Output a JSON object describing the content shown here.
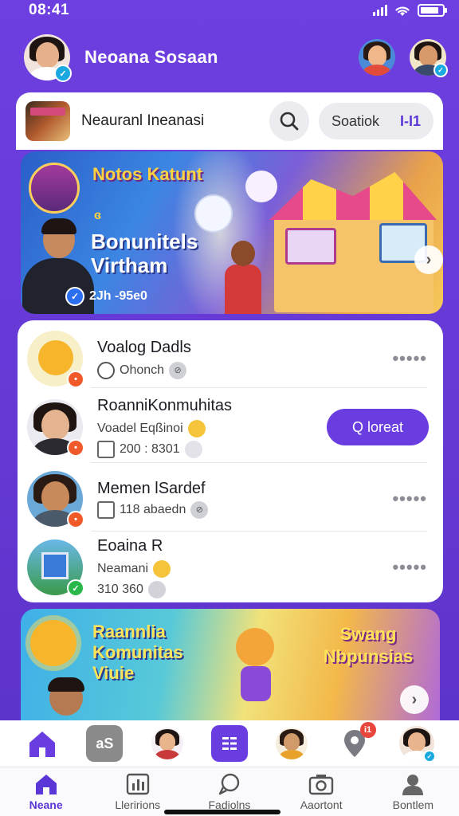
{
  "status_bar": {
    "time": "08:41"
  },
  "header": {
    "title": "Neoana Sosaan"
  },
  "search": {
    "label": "Neauranl Ineanasi",
    "pill_label": "Soatiok",
    "pill_filter": "I-I1"
  },
  "banner": {
    "title1": "Notos Katunt",
    "small": "ɞ",
    "title2": "Bonunitels Virtham",
    "meta": "2Jh -95e0"
  },
  "list": [
    {
      "name": "Voalog Dadls",
      "sub": "Ohonch",
      "meta": ""
    },
    {
      "name": "RoanniKonmuhitas",
      "sub": "Voadel Eqßinoi",
      "meta": "200 : 8301",
      "action": "Q loreat"
    },
    {
      "name": "Memen lSardef",
      "sub": "",
      "meta": "118 abaedn"
    },
    {
      "name": "Eoaina R",
      "sub": "Neamani",
      "meta": "310 360"
    }
  ],
  "banner2": {
    "title1": "Raannlia Komunitas Viuie",
    "title2": "Swang Nbpunsias"
  },
  "icon_strip": {
    "notif_count": "i1"
  },
  "tabs": [
    {
      "label": "Neane",
      "icon": "home-icon"
    },
    {
      "label": "Lleririons",
      "icon": "chart-icon"
    },
    {
      "label": "Fadiolns",
      "icon": "chat-icon"
    },
    {
      "label": "Aaortont",
      "icon": "camera-icon"
    },
    {
      "label": "Bontlem",
      "icon": "profile-icon"
    }
  ],
  "colors": {
    "brand": "#6a3de0",
    "background": "#6a3bd8",
    "active_tab": "#5b36d6"
  }
}
